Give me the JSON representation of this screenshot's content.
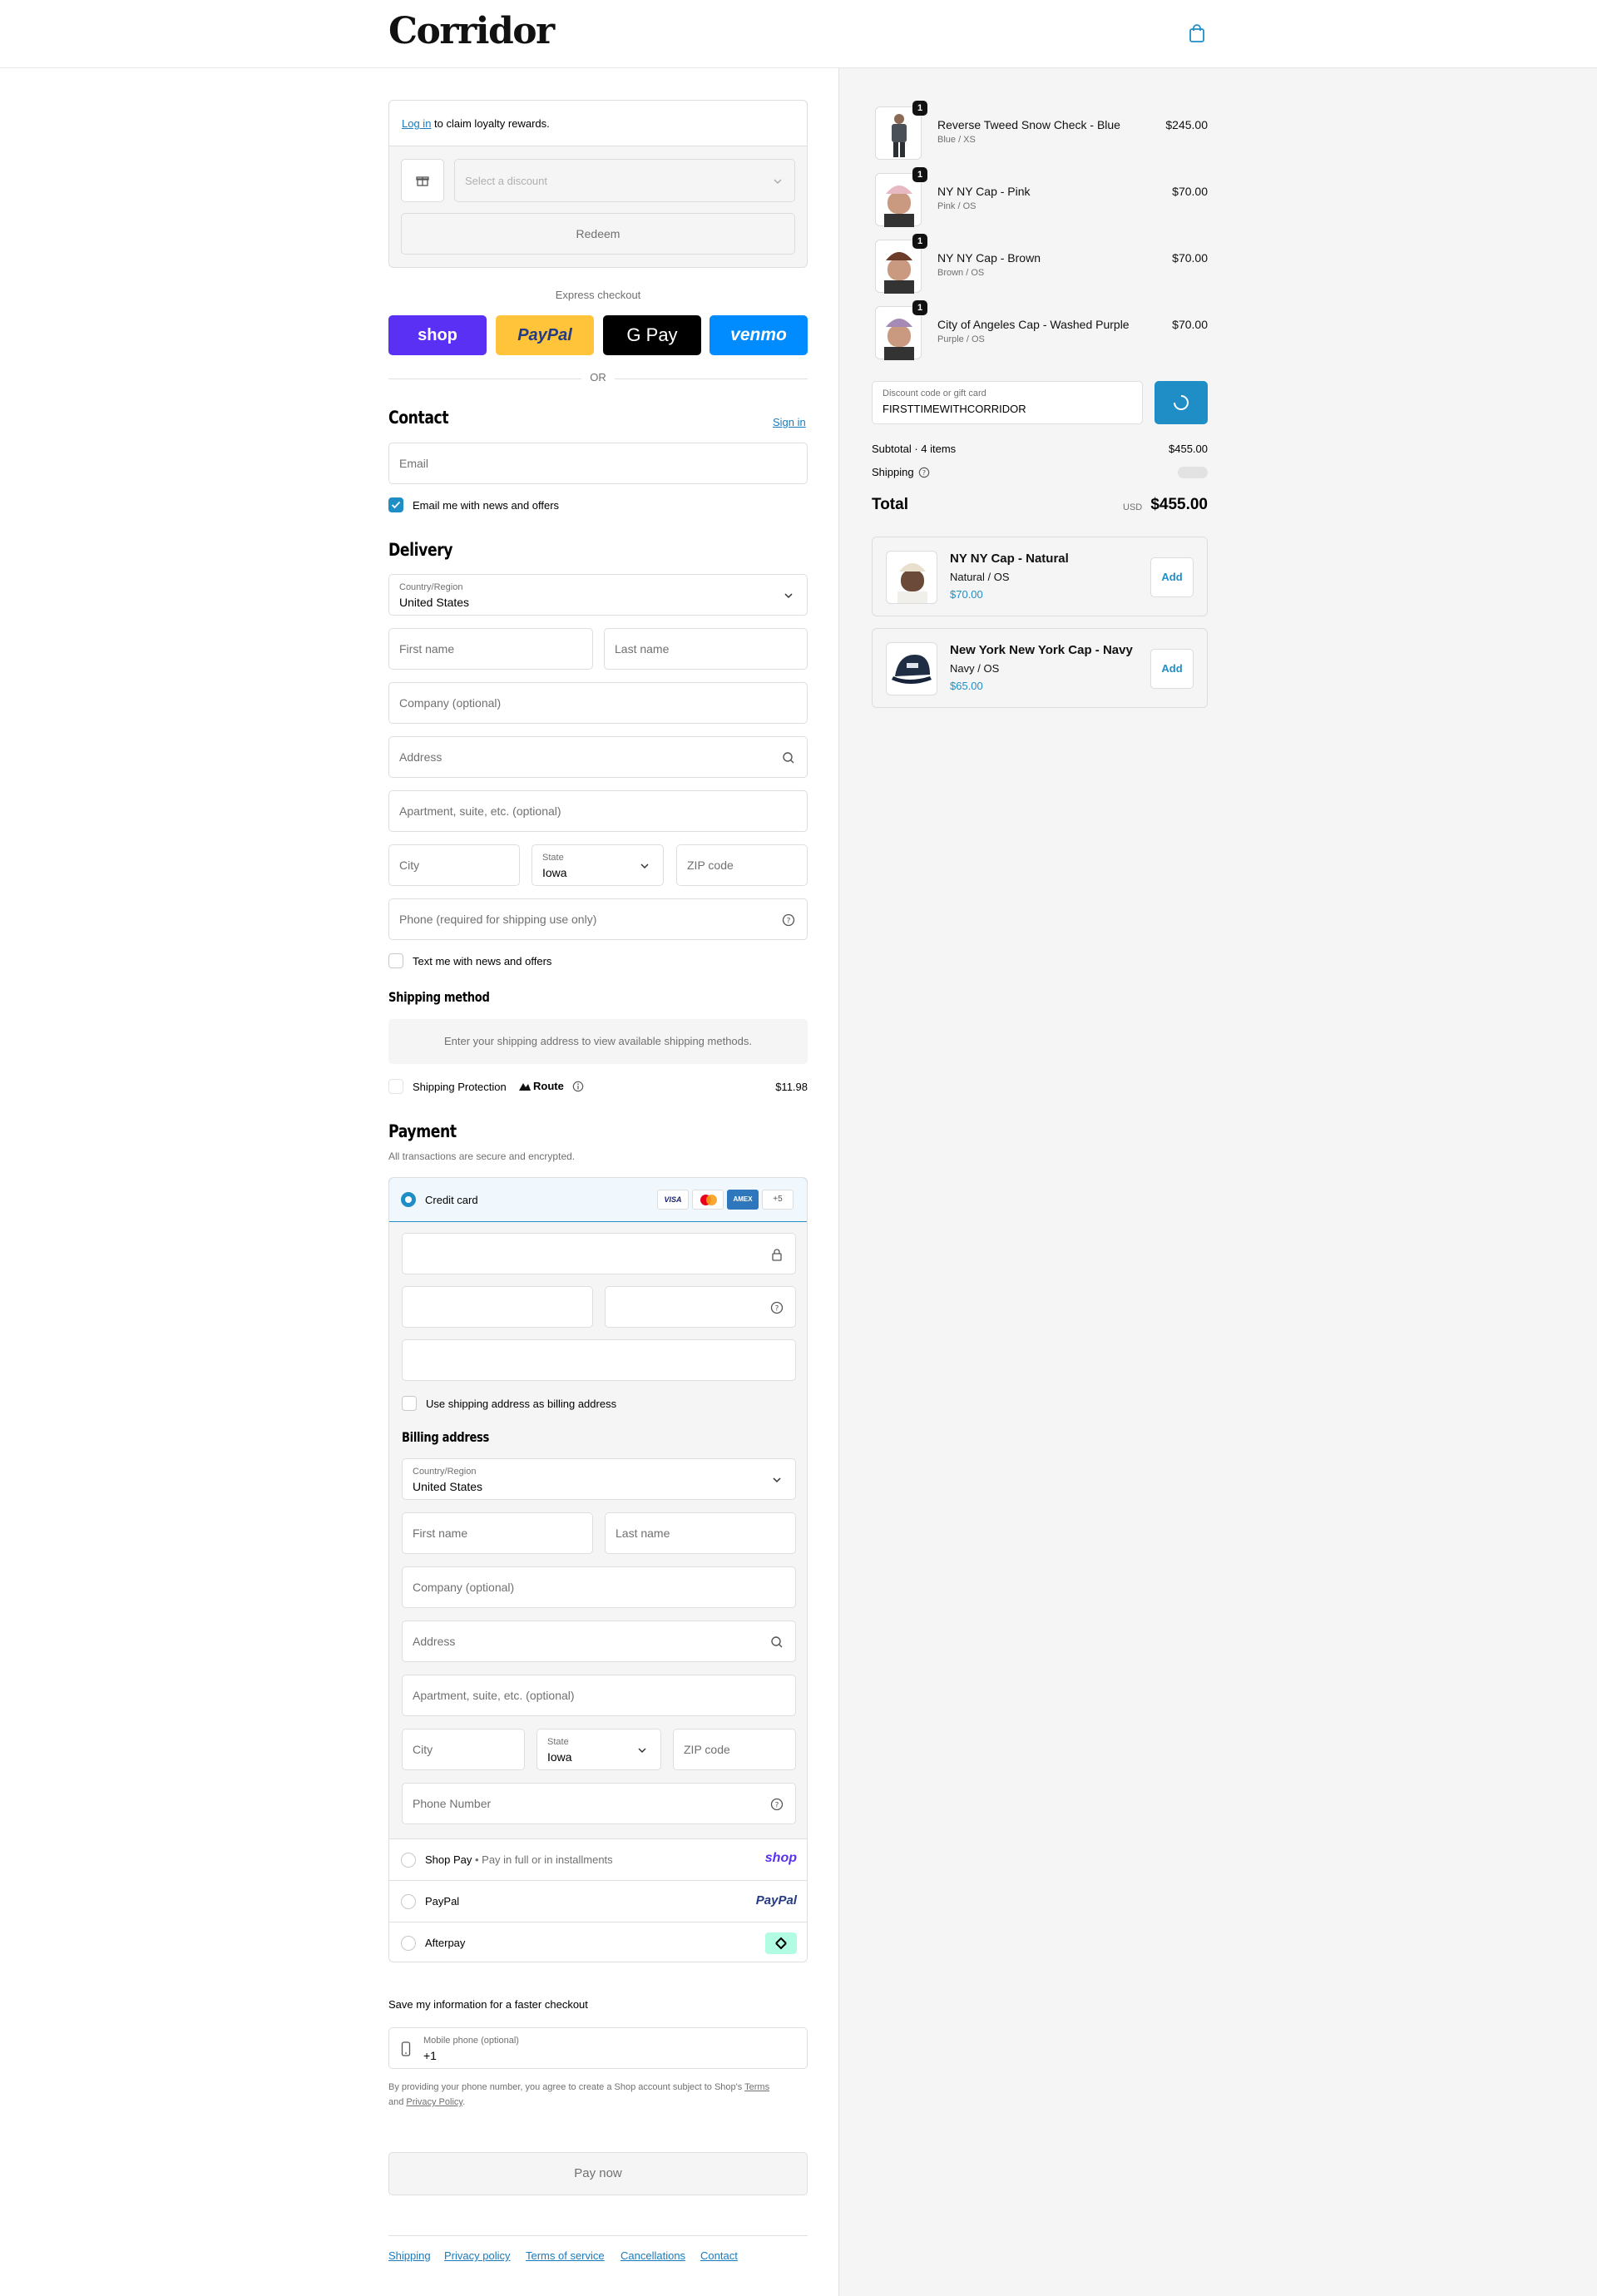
{
  "header": {
    "logo": "Corridor",
    "cart_icon": "shopping-bag-icon"
  },
  "loyalty": {
    "login_link": "Log in",
    "login_text": " to claim loyalty rewards.",
    "discount_placeholder": "Select a discount",
    "redeem_label": "Redeem"
  },
  "express": {
    "title": "Express checkout",
    "buttons": [
      "shop",
      "PayPal",
      "G Pay",
      "venmo"
    ],
    "or": "OR"
  },
  "contact": {
    "heading": "Contact",
    "sign_in": "Sign in",
    "email_placeholder": "Email",
    "newsletter": "Email me with news and offers"
  },
  "delivery": {
    "heading": "Delivery",
    "country_label": "Country/Region",
    "country_value": "United States",
    "first_name": "First name",
    "last_name": "Last name",
    "company": "Company (optional)",
    "address": "Address",
    "apartment": "Apartment, suite, etc. (optional)",
    "city": "City",
    "state_label": "State",
    "state_value": "Iowa",
    "zip": "ZIP code",
    "phone": "Phone (required for shipping use only)",
    "text_me": "Text me with news and offers"
  },
  "shipping": {
    "heading": "Shipping method",
    "notice": "Enter your shipping address to view available shipping methods.",
    "protection_label": "Shipping Protection",
    "route_brand": "Route",
    "protection_price": "$11.98"
  },
  "payment": {
    "heading": "Payment",
    "subtitle": "All transactions are secure and encrypted.",
    "credit_card": "Credit card",
    "card_brands": [
      "VISA",
      "mastercard",
      "AMEX",
      "+5"
    ],
    "use_shipping": "Use shipping address as billing address",
    "billing_heading": "Billing address",
    "billing": {
      "country_label": "Country/Region",
      "country_value": "United States",
      "first_name": "First name",
      "last_name": "Last name",
      "company": "Company (optional)",
      "address": "Address",
      "apartment": "Apartment, suite, etc. (optional)",
      "city": "City",
      "state_label": "State",
      "state_value": "Iowa",
      "zip": "ZIP code",
      "phone": "Phone Number"
    },
    "shop_pay": "Shop Pay",
    "shop_pay_note": "Pay in full or in installments",
    "shop_pay_logo": "shop",
    "paypal": "PayPal",
    "paypal_logo": "PayPal",
    "afterpay": "Afterpay"
  },
  "remember": {
    "title": "Save my information for a faster checkout",
    "mobile_label": "Mobile phone (optional)",
    "mobile_value": "+1",
    "terms_pre": "By providing your phone number, you agree to create a Shop account subject to Shop's ",
    "terms_link": "Terms",
    "terms_and": "and ",
    "privacy_link": "Privacy Policy",
    "terms_end": "."
  },
  "pay_now": "Pay now",
  "footer": [
    "Shipping",
    "Privacy policy",
    "Terms of service",
    "Cancellations",
    "Contact"
  ],
  "summary": {
    "items": [
      {
        "qty": "1",
        "name": "Reverse Tweed Snow Check - Blue",
        "variant": "Blue / XS",
        "price": "$245.00"
      },
      {
        "qty": "1",
        "name": "NY NY Cap - Pink",
        "variant": "Pink / OS",
        "price": "$70.00"
      },
      {
        "qty": "1",
        "name": "NY NY Cap - Brown",
        "variant": "Brown / OS",
        "price": "$70.00"
      },
      {
        "qty": "1",
        "name": "City of Angeles Cap - Washed Purple",
        "variant": "Purple / OS",
        "price": "$70.00"
      }
    ],
    "discount_label": "Discount code or gift card",
    "discount_value": "FIRSTTIMEWITHCORRIDOR",
    "subtotal_label": "Subtotal · 4 items",
    "subtotal_value": "$455.00",
    "shipping_label": "Shipping",
    "total_label": "Total",
    "currency": "USD",
    "total_value": "$455.00",
    "upsells": [
      {
        "name": "NY NY Cap - Natural",
        "variant": "Natural / OS",
        "price": "$70.00",
        "add": "Add"
      },
      {
        "name": "New York New York Cap - Navy",
        "variant": "Navy / OS",
        "price": "$65.00",
        "add": "Add"
      }
    ]
  },
  "colors": {
    "accent": "#1f8ec7",
    "shop": "#5a31f4",
    "paypal": "#ffc439",
    "venmo": "#008cff"
  }
}
